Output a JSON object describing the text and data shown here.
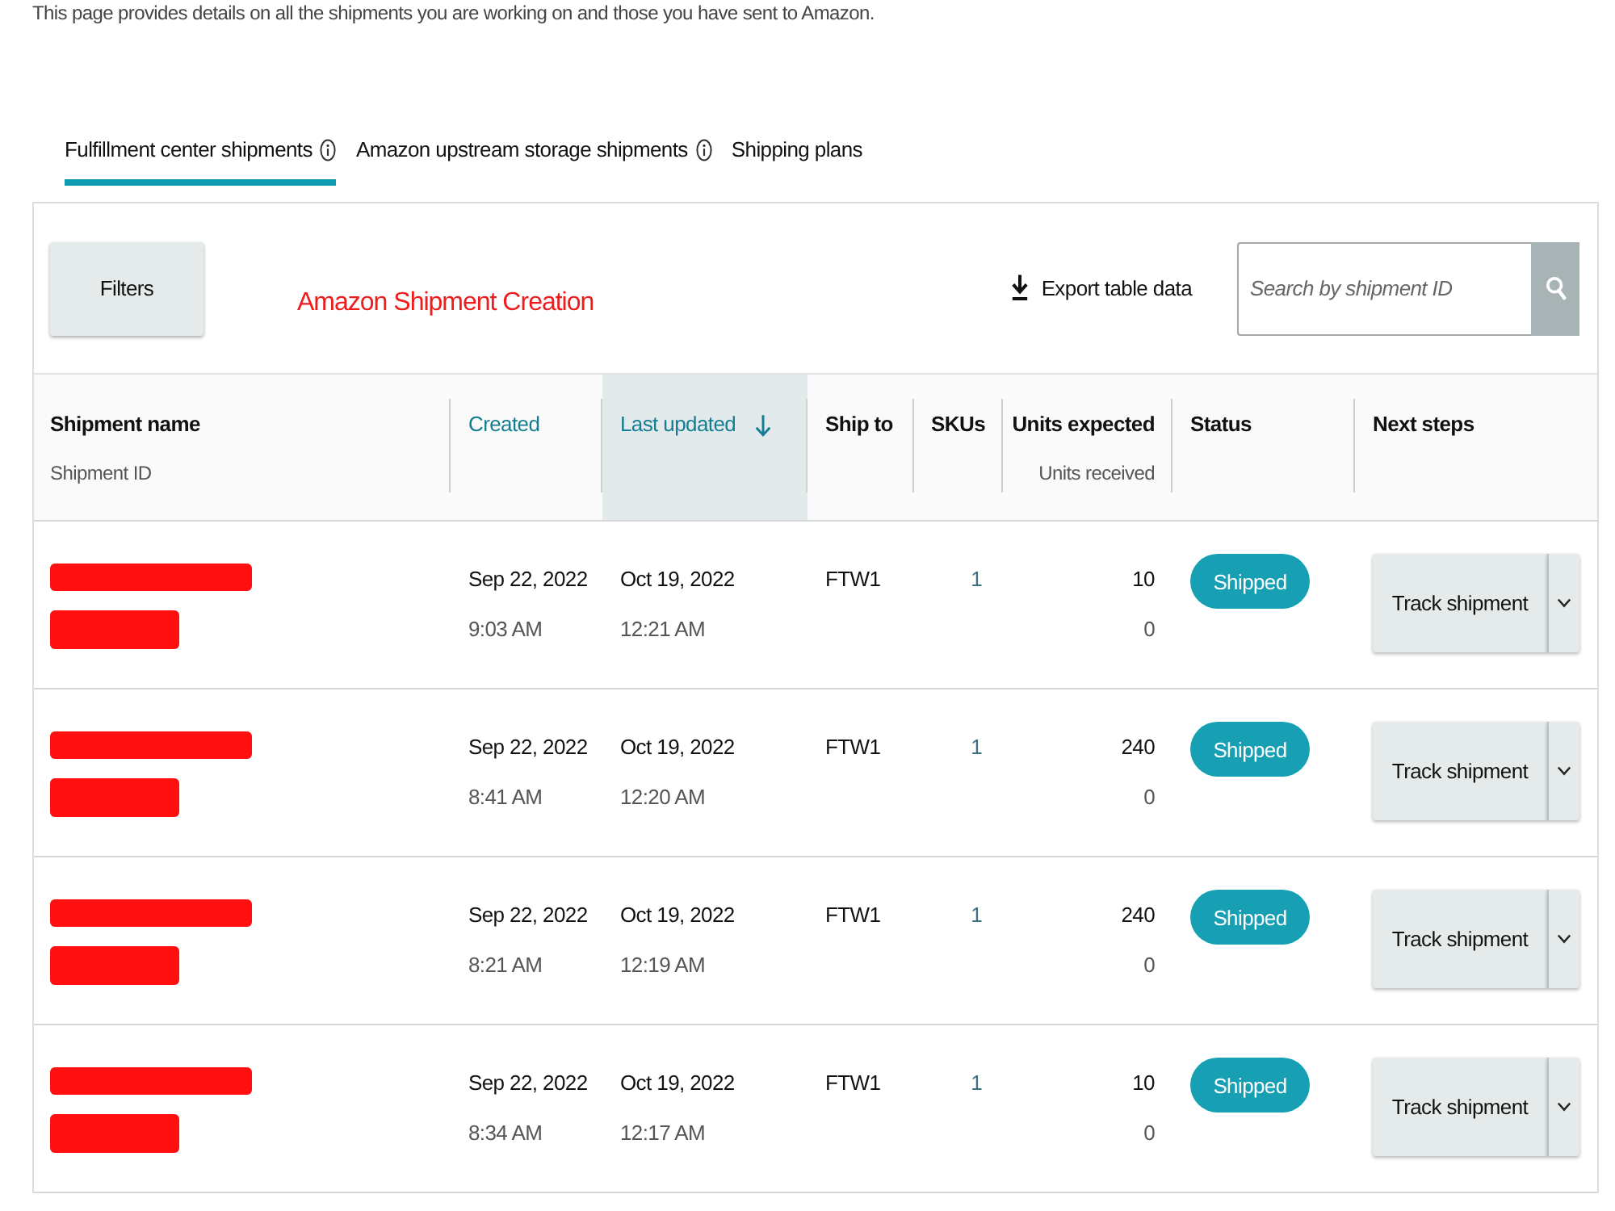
{
  "intro": "This page provides details on all the shipments you are working on and those you have sent to Amazon.",
  "tabs": [
    {
      "label": "Fulfillment center shipments",
      "info": true,
      "selected": true
    },
    {
      "label": "Amazon upstream storage shipments",
      "info": true,
      "selected": false
    },
    {
      "label": "Shipping plans",
      "info": false,
      "selected": false
    }
  ],
  "toolbar": {
    "filters_button": "Filters",
    "annotation": "Amazon Shipment Creation",
    "export_button": "Export table data",
    "search": {
      "placeholder": "Search by shipment ID"
    }
  },
  "table": {
    "columns": [
      {
        "label": "Shipment name",
        "sublabel": "Shipment ID",
        "sortable": false,
        "sorted": false
      },
      {
        "label": "Created",
        "sortable": true,
        "sorted": false
      },
      {
        "label": "Last updated",
        "sortable": true,
        "sorted": true
      },
      {
        "label": "Ship to",
        "sortable": false,
        "sorted": false
      },
      {
        "label": "SKUs",
        "sortable": false,
        "sorted": false
      },
      {
        "label": "Units expected",
        "sublabel": "Units received",
        "sortable": false,
        "sorted": false
      },
      {
        "label": "Status",
        "sortable": false,
        "sorted": false
      },
      {
        "label": "Next steps",
        "sortable": false,
        "sorted": false
      }
    ],
    "rows": [
      {
        "redacted": true,
        "created_date": "Sep 22, 2022",
        "created_time": "9:03 AM",
        "updated_date": "Oct 19, 2022",
        "updated_time": "12:21 AM",
        "ship_to": "FTW1",
        "skus": "1",
        "units_expected": "10",
        "units_received": "0",
        "status": "Shipped",
        "next_step": "Track shipment"
      },
      {
        "redacted": true,
        "created_date": "Sep 22, 2022",
        "created_time": "8:41 AM",
        "updated_date": "Oct 19, 2022",
        "updated_time": "12:20 AM",
        "ship_to": "FTW1",
        "skus": "1",
        "units_expected": "240",
        "units_received": "0",
        "status": "Shipped",
        "next_step": "Track shipment"
      },
      {
        "redacted": true,
        "created_date": "Sep 22, 2022",
        "created_time": "8:21 AM",
        "updated_date": "Oct 19, 2022",
        "updated_time": "12:19 AM",
        "ship_to": "FTW1",
        "skus": "1",
        "units_expected": "240",
        "units_received": "0",
        "status": "Shipped",
        "next_step": "Track shipment"
      },
      {
        "redacted": true,
        "created_date": "Sep 22, 2022",
        "created_time": "8:34 AM",
        "updated_date": "Oct 19, 2022",
        "updated_time": "12:17 AM",
        "ship_to": "FTW1",
        "skus": "1",
        "units_expected": "10",
        "units_received": "0",
        "status": "Shipped",
        "next_step": "Track shipment"
      }
    ]
  }
}
